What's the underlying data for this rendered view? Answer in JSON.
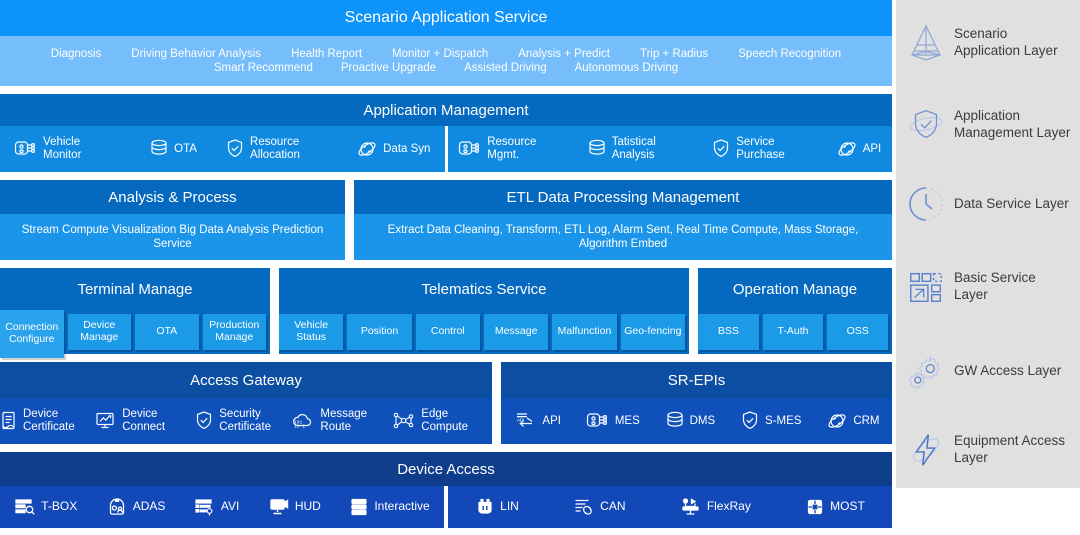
{
  "colors": {
    "scenario_head": "#0d93fa",
    "scenario_sub": "#75bdfb",
    "appmgmt_head": "#0569c0",
    "appmgmt_sub": "#0f8ae0",
    "data_head": "#0569c0",
    "data_sub": "#1b95e9",
    "basic_head": "#0569c0",
    "basic_chip": "#1b9ae8",
    "gw_head": "#0b4ea2",
    "gw_sub": "#0f50ba",
    "device_head": "#0e3d8c",
    "device_sub": "#1348b8",
    "sidebar_bg": "#e0e0e0",
    "sidebar_text": "#3b3b3b"
  },
  "scenario": {
    "title": "Scenario Application Service",
    "tags_line1": [
      "Diagnosis",
      "Driving Behavior Analysis",
      "Health Report",
      "Monitor + Dispatch",
      "Analysis + Predict",
      "Trip + Radius",
      "Speech Recognition"
    ],
    "tags_line2": [
      "Smart Recommend",
      "Proactive Upgrade",
      "Assisted Driving",
      "Autonomous Driving"
    ]
  },
  "app_management": {
    "title": "Application Management",
    "left_items": [
      {
        "label": "Vehicle Monitor",
        "icon": "device-node-icon"
      },
      {
        "label": "OTA",
        "icon": "database-icon"
      },
      {
        "label": "Resource Allocation",
        "icon": "shield-check-icon"
      },
      {
        "label": "Data Syn",
        "icon": "sync-orbit-icon"
      }
    ],
    "right_items": [
      {
        "label": "Resource Mgmt.",
        "icon": "device-node-icon"
      },
      {
        "label": "Tatistical Analysis",
        "icon": "database-icon"
      },
      {
        "label": "Service Purchase",
        "icon": "shield-check-icon"
      },
      {
        "label": "API",
        "icon": "sync-orbit-icon"
      }
    ]
  },
  "data_service": {
    "left": {
      "title": "Analysis & Process",
      "body": "Stream Compute  Visualization   Big Data Analysis Prediction Service"
    },
    "right": {
      "title": "ETL Data Processing Management",
      "body": "Extract  Data Cleaning, Transform,  ETL Log,  Alarm Sent, Real Time Compute, Mass Storage, Algorithm Embed"
    }
  },
  "basic_service": {
    "groups": [
      {
        "title": "Terminal Manage",
        "chips": [
          "Connection Configure",
          "Device Manage",
          "OTA",
          "Production Manage"
        ]
      },
      {
        "title": "Telematics Service",
        "chips": [
          "Vehicle Status",
          "Position",
          "Control",
          "Message",
          "Malfunction",
          "Geo-fencing"
        ]
      },
      {
        "title": "Operation Manage",
        "chips": [
          "BSS",
          "T-Auth",
          "OSS"
        ]
      }
    ]
  },
  "gw_access": {
    "left": {
      "title": "Access Gateway",
      "items": [
        {
          "label": "Device Certificate",
          "icon": "certificate-doc-icon"
        },
        {
          "label": "Device Connect",
          "icon": "monitor-chart-icon"
        },
        {
          "label": "Security Certificate",
          "icon": "shield-check-icon"
        },
        {
          "label": "Message Route",
          "icon": "cloud-binary-icon"
        },
        {
          "label": "Edge Compute",
          "icon": "network-nodes-icon"
        }
      ]
    },
    "right": {
      "title": "SR-EPIs",
      "items": [
        {
          "label": "API",
          "icon": "api-arrow-icon"
        },
        {
          "label": "MES",
          "icon": "device-node-icon"
        },
        {
          "label": "DMS",
          "icon": "database-icon"
        },
        {
          "label": "S-MES",
          "icon": "shield-check-icon"
        },
        {
          "label": "CRM",
          "icon": "sync-orbit-icon"
        }
      ]
    }
  },
  "device_access": {
    "title": "Device Access",
    "left_items": [
      {
        "label": "T-BOX",
        "icon": "list-search-icon"
      },
      {
        "label": "ADAS",
        "icon": "camera-sensor-icon"
      },
      {
        "label": "AVI",
        "icon": "form-list-icon"
      },
      {
        "label": "HUD",
        "icon": "display-icon"
      },
      {
        "label": "Interactive",
        "icon": "stacked-bars-icon"
      }
    ],
    "right_items": [
      {
        "label": "LIN",
        "icon": "connector-port-icon"
      },
      {
        "label": "CAN",
        "icon": "bus-signal-icon"
      },
      {
        "label": "FlexRay",
        "icon": "usb-branch-icon"
      },
      {
        "label": "MOST",
        "icon": "chip-icon"
      }
    ]
  },
  "sidebar": {
    "items": [
      {
        "label": "Scenario Application Layer",
        "icon": "pyramid-icon"
      },
      {
        "label": "Application Management Layer",
        "icon": "shield-orbit-icon"
      },
      {
        "label": "Data Service Layer",
        "icon": "clock-icon"
      },
      {
        "label": "Basic Service Layer",
        "icon": "grid-arrow-icon"
      },
      {
        "label": "GW  Access Layer",
        "icon": "gears-icon"
      },
      {
        "label": "Equipment Access Layer",
        "icon": "bolt-orbit-icon"
      }
    ]
  }
}
